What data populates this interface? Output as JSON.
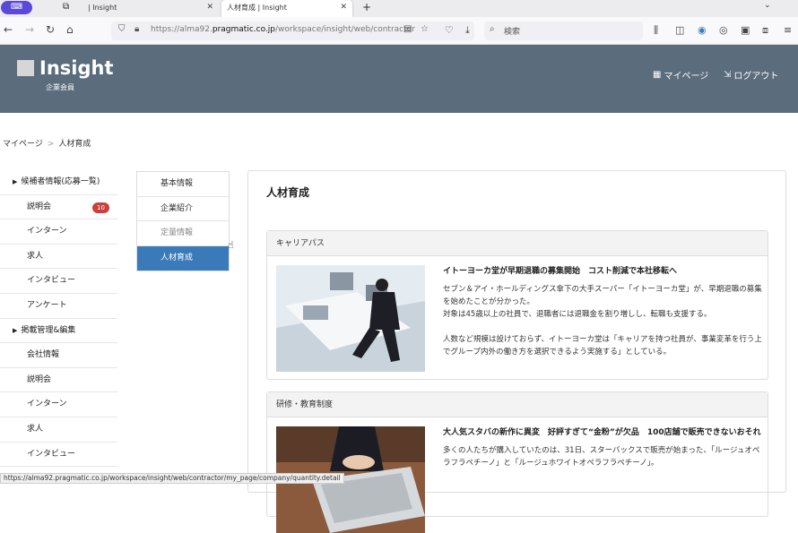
{
  "browser": {
    "ext_label": "⌨",
    "tabs": [
      {
        "title": "| Insight",
        "close": "✕"
      },
      {
        "title": "人材育成 | Insight",
        "close": "✕"
      }
    ],
    "new_tab": "+",
    "tab_menu": "⌄",
    "url_prefix": "https://alma92.",
    "url_domain": "pragmatic.co.jp",
    "url_path": "/workspace/insight/web/contractor",
    "search_placeholder": "検索",
    "status_url": "https://alma92.pragmatic.co.jp/workspace/insight/web/contractor/my_page/company/quantity.detail"
  },
  "header": {
    "logo": "Insight",
    "logo_sub": "企業会員",
    "mypage": "マイページ",
    "logout": "ログアウト"
  },
  "breadcrumb": {
    "home": "マイページ",
    "sep": ">",
    "current": "人材育成"
  },
  "sidebar": {
    "items": [
      {
        "label": "候補者情報(応募一覧)",
        "group": true
      },
      {
        "label": "説明会",
        "badge": "10"
      },
      {
        "label": "インターン"
      },
      {
        "label": "求人"
      },
      {
        "label": "インタビュー"
      },
      {
        "label": "アンケート"
      },
      {
        "label": "掲載管理&編集",
        "group": true
      },
      {
        "label": "会社情報"
      },
      {
        "label": "説明会"
      },
      {
        "label": "インターン"
      },
      {
        "label": "求人"
      },
      {
        "label": "インタビュー"
      }
    ]
  },
  "subnav": {
    "items": [
      {
        "label": "基本情報"
      },
      {
        "label": "企業紹介"
      },
      {
        "label": "定量情報"
      },
      {
        "label": "人材育成"
      }
    ],
    "active": 3
  },
  "main": {
    "title": "人材育成",
    "cards": [
      {
        "header": "キャリアパス",
        "title": "イトーヨーカ堂が早期退職の募集開始　コスト削減で本社移転へ",
        "text1": "セブン＆アイ・ホールディングス傘下の大手スーパー「イトーヨーカ堂」が、早期退職の募集を始めたことが分かった。",
        "text2": "対象は45歳以上の社員で、退職者には退職金を割り増しし、転職も支援する。",
        "text3": "人数など規模は設けておらず、イトーヨーカ堂は「キャリアを持つ社員が、事業変革を行う上でグループ内外の働き方を選択できるよう実施する」としている。"
      },
      {
        "header": "研修・教育制度",
        "title": "大人気スタバの新作に異変　好評すぎて“金粉”が欠品　100店舗で販売できないおそれ",
        "text1": "多くの人たちが購入していたのは、31日、スターバックスで販売が始まった、「ルージュオペラフラペチーノ」と「ルージュホワイトオペラフラペチーノ」。"
      }
    ]
  }
}
